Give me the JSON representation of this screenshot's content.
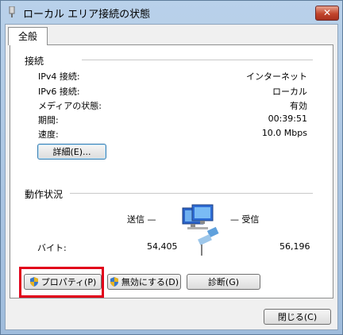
{
  "window": {
    "title": "ローカル エリア接続の状態",
    "close_label": "✕"
  },
  "tabs": [
    {
      "label": "全般"
    }
  ],
  "connection": {
    "section_label": "接続",
    "rows": [
      {
        "label": "IPv4 接続:",
        "value": "インターネット"
      },
      {
        "label": "IPv6 接続:",
        "value": "ローカル"
      },
      {
        "label": "メディアの状態:",
        "value": "有効"
      },
      {
        "label": "期間:",
        "value": "00:39:51"
      },
      {
        "label": "速度:",
        "value": "10.0 Mbps"
      }
    ],
    "details_button": "詳細(E)..."
  },
  "activity": {
    "section_label": "動作状況",
    "sent_label": "送信 —",
    "received_label": "— 受信",
    "bytes_label": "バイト:",
    "sent_bytes": "54,405",
    "received_bytes": "56,196"
  },
  "buttons": {
    "properties": "プロパティ(P)",
    "disable": "無効にする(D)",
    "diagnose": "診断(G)",
    "close": "閉じる(C)"
  },
  "colors": {
    "highlight_box": "#e1001a",
    "titlebar": "#b9d1ea"
  }
}
